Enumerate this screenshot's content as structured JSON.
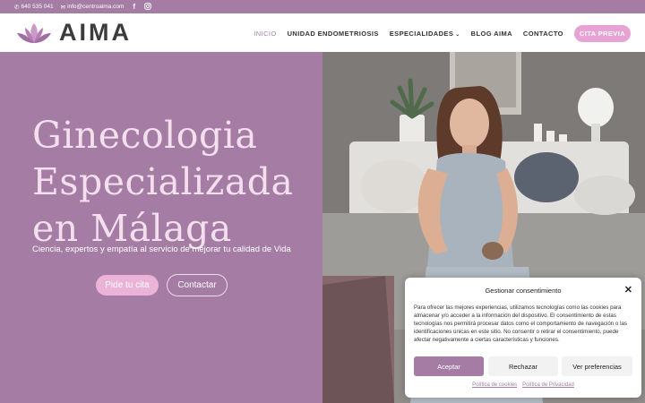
{
  "topbar": {
    "phone": "640 535 041",
    "email": "info@centroaima.com",
    "facebook_icon": "facebook-icon",
    "instagram_icon": "instagram-icon"
  },
  "header": {
    "logo_text": "AIMA",
    "nav": [
      {
        "label": "INICIO",
        "active": true
      },
      {
        "label": "UNIDAD ENDOMETRIOSIS"
      },
      {
        "label": "ESPECIALIDADES",
        "dropdown": true
      },
      {
        "label": "BLOG AIMA"
      },
      {
        "label": "CONTACTO"
      }
    ],
    "cta": "CITA PREVIA"
  },
  "hero": {
    "title_lines": [
      "Ginecologia",
      "Especializada",
      "en Málaga"
    ],
    "subtitle": "Ciencia, expertos y empatía al servicio de mejorar tu calidad de Vida",
    "primary_button": "Pide tu cita",
    "secondary_button": "Contactar"
  },
  "cookie": {
    "title": "Gestionar consentimiento",
    "body": "Para ofrecer las mejores experiencias, utilizamos tecnologías como las cookies para almacenar y/o acceder a la información del dispositivo. El consentimiento de estas tecnologías nos permitirá procesar datos como el comportamiento de navegación o las identificaciones únicas en este sitio. No consentir o retirar el consentimiento, puede afectar negativamente a ciertas características y funciones.",
    "accept": "Aceptar",
    "reject": "Rechazar",
    "preferences": "Ver preferencias",
    "link_cookies": "Política de cookies",
    "link_privacy": "Política de Privacidad"
  },
  "colors": {
    "brand": "#a47ca4",
    "cta_pink": "#e7a3d4",
    "title_pink": "#f3dfee"
  }
}
